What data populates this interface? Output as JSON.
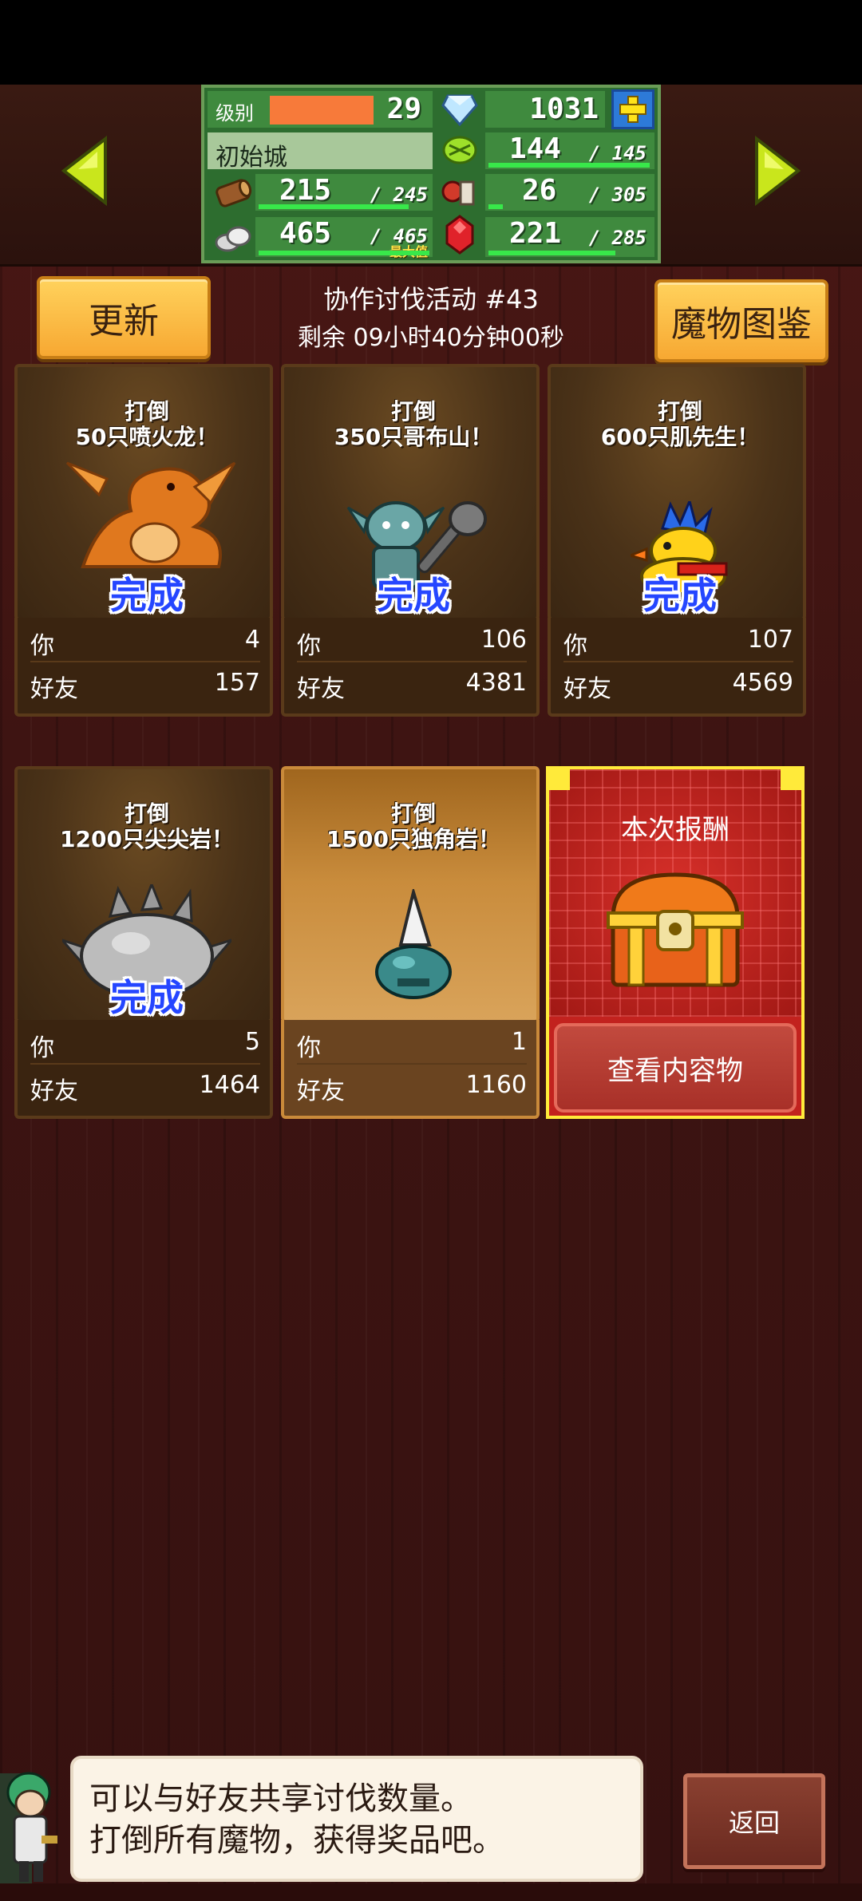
{
  "stats": {
    "level_label": "级别",
    "level": "29",
    "gems": "1031",
    "town": "初始城",
    "food": "144",
    "food_max": "/ 145",
    "wood": "215",
    "wood_max": "/ 245",
    "meat": "26",
    "meat_max": "/ 305",
    "stone": "465",
    "stone_max": "/ 465",
    "max_tag": "最大值",
    "ruby": "221",
    "ruby_max": "/ 285",
    "food_progress": 0.99,
    "wood_progress": 0.88,
    "meat_progress": 0.09,
    "stone_progress": 1.0,
    "ruby_progress": 0.78
  },
  "header": {
    "refresh_label": "更新",
    "monster_book_label": "魔物图鉴",
    "event_title": "协作讨伐活动 #43",
    "time_left": "剩余 09小时40分钟00秒"
  },
  "cards": [
    {
      "title1": "打倒",
      "title2": "50只喷火龙！",
      "done": "完成",
      "you_label": "你",
      "you": "4",
      "friends_label": "好友",
      "friends": "157",
      "monster_icon": "fire-dragon-icon"
    },
    {
      "title1": "打倒",
      "title2": "350只哥布山！",
      "done": "完成",
      "you_label": "你",
      "you": "106",
      "friends_label": "好友",
      "friends": "4381",
      "monster_icon": "goblin-icon"
    },
    {
      "title1": "打倒",
      "title2": "600只肌先生！",
      "done": "完成",
      "you_label": "你",
      "you": "107",
      "friends_label": "好友",
      "friends": "4569",
      "monster_icon": "duck-icon"
    },
    {
      "title1": "打倒",
      "title2": "1200只尖尖岩！",
      "done": "完成",
      "you_label": "你",
      "you": "5",
      "friends_label": "好友",
      "friends": "1464",
      "monster_icon": "spiky-rock-icon"
    },
    {
      "title1": "打倒",
      "title2": "1500只独角岩！",
      "done": "",
      "you_label": "你",
      "you": "1",
      "friends_label": "好友",
      "friends": "1160",
      "monster_icon": "horned-slime-icon"
    }
  ],
  "reward": {
    "title": "本次报酬",
    "button": "查看内容物"
  },
  "dialog": {
    "line1": "可以与好友共享讨伐数量。",
    "line2": "打倒所有魔物，获得奖品吧。"
  },
  "back_label": "返回",
  "colors": {
    "done_text": "#2546ff",
    "panel_green": "#3f8a3e",
    "accent_yellow": "#f7a832",
    "reward_red": "#c2221e"
  }
}
